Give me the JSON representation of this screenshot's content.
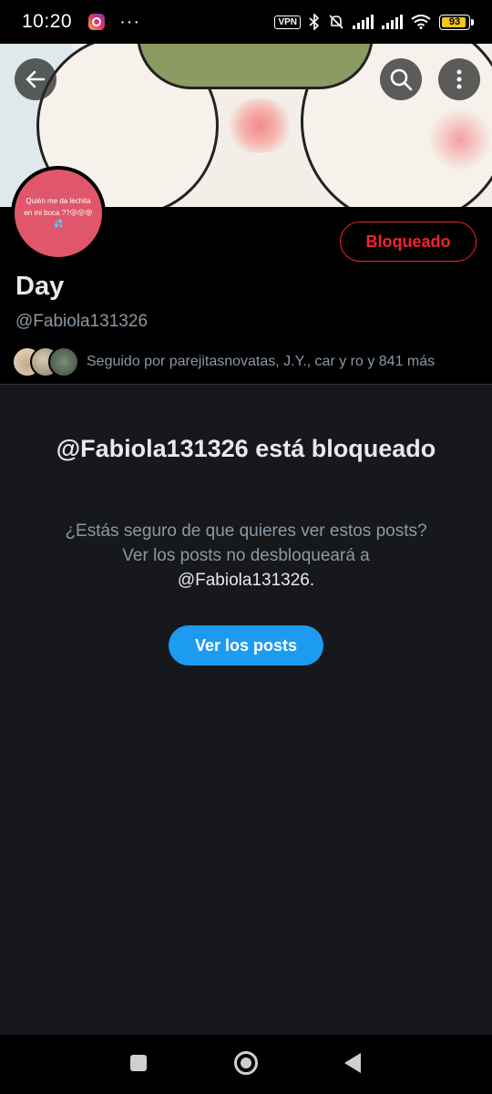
{
  "status_bar": {
    "time": "10:20",
    "overflow": "···",
    "vpn": "VPN",
    "battery": "93"
  },
  "profile": {
    "avatar_text": "Quién me da lechita en mi boca ??😛😛😝💦",
    "display_name": "Day",
    "handle": "@Fabiola131326",
    "blocked_button": "Bloqueado",
    "followed_by": "Seguido por parejitasnovatas, J.Y., car y ro y 841 más"
  },
  "blocked_panel": {
    "title": "@Fabiola131326 está bloqueado",
    "description": "¿Estás seguro de que quieres ver estos posts? Ver los posts no desbloqueará a ",
    "description_handle": "@Fabiola131326.",
    "button": "Ver los posts"
  },
  "icons": {
    "back": "back-arrow-icon",
    "search": "search-icon",
    "more": "more-vertical-icon"
  },
  "colors": {
    "accent": "#1d9bf0",
    "blocked": "#f4212e",
    "panel_bg": "#16181c",
    "muted_text": "#8b98a5"
  }
}
